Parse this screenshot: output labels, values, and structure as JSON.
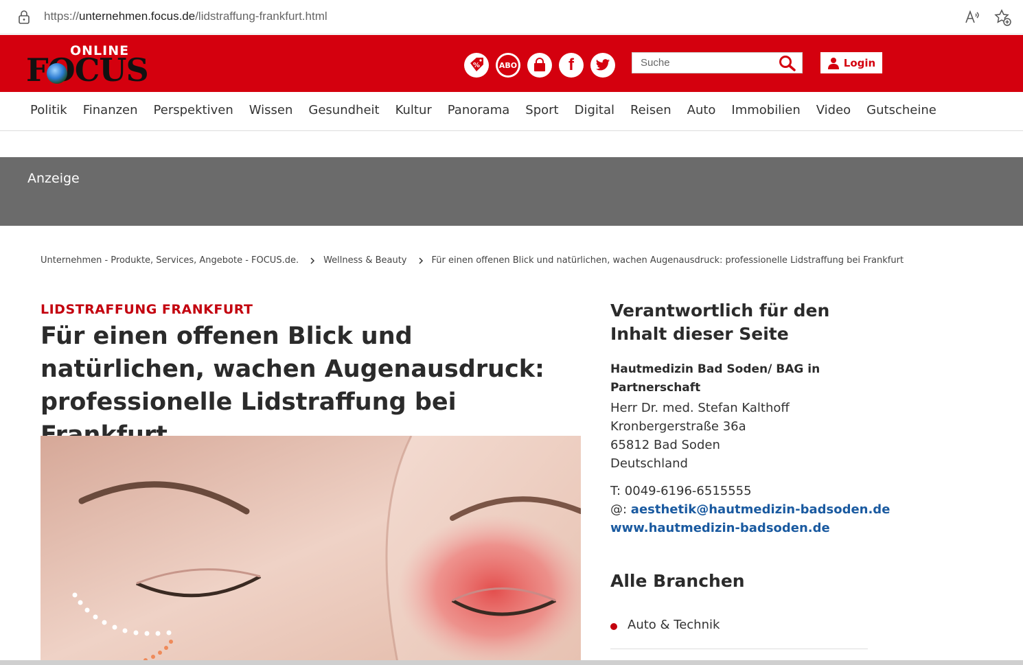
{
  "browser": {
    "url_prefix": "https://",
    "url_host": "unternehmen.focus.de",
    "url_path": "/lidstraffung-frankfurt.html"
  },
  "header": {
    "logo_top": "ONLINE",
    "logo_main": "FOCUS",
    "abo_label": "ABO",
    "facebook_glyph": "f",
    "search_placeholder": "Suche",
    "login_label": "Login",
    "brand_color": "#d4000e"
  },
  "nav": {
    "items": [
      "Politik",
      "Finanzen",
      "Perspektiven",
      "Wissen",
      "Gesundheit",
      "Kultur",
      "Panorama",
      "Sport",
      "Digital",
      "Reisen",
      "Auto",
      "Immobilien",
      "Video",
      "Gutscheine"
    ]
  },
  "ad": {
    "label": "Anzeige"
  },
  "breadcrumb": {
    "items": [
      "Unternehmen - Produkte, Services, Angebote - FOCUS.de.",
      "Wellness & Beauty",
      "Für einen offenen Blick und natürlichen, wachen Augenausdruck: professionelle Lidstraffung bei Frankfurt"
    ]
  },
  "article": {
    "kicker": "LIDSTRAFFUNG FRANKFURT",
    "title": "Für einen offenen Blick und natürlichen, wachen Augenausdruck: professionelle Lidstraffung bei Frankfurt"
  },
  "sidebar": {
    "heading": "Verantwortlich für den Inhalt dieser Seite",
    "company": "Hautmedizin Bad Soden/ BAG in Partnerschaft",
    "address": [
      "Herr Dr. med. Stefan Kalthoff",
      "Kronbergerstraße 36a",
      "65812 Bad Soden",
      "Deutschland"
    ],
    "phone": "T: 0049-6196-6515555",
    "email_prefix": "@: ",
    "email": "aesthetik@hautmedizin-badsoden.de",
    "website": "www.hautmedizin-badsoden.de",
    "branchen_heading": "Alle Branchen",
    "branchen": [
      "Auto & Technik"
    ]
  }
}
